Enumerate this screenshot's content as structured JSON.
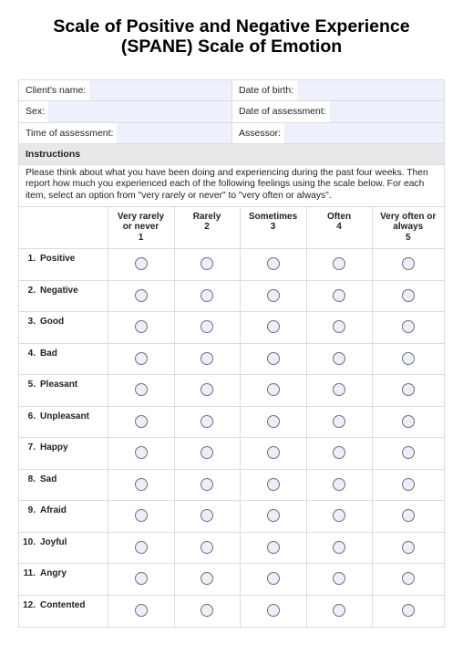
{
  "title_line1": "Scale of Positive and Negative Experience",
  "title_line2": "(SPANE) Scale of Emotion",
  "info": {
    "client_name_label": "Client's name:",
    "client_name_value": "",
    "dob_label": "Date of birth:",
    "dob_value": "",
    "sex_label": "Sex:",
    "sex_value": "",
    "date_assessment_label": "Date of assessment:",
    "date_assessment_value": "",
    "time_assessment_label": "Time of assessment:",
    "time_assessment_value": "",
    "assessor_label": "Assessor:",
    "assessor_value": ""
  },
  "instructions": {
    "heading": "Instructions",
    "text": "Please think about what you have been doing and experiencing during the past four weeks. Then report how much you experienced each of the following feelings using the scale below. For each item, select an option from \"very rarely or never\" to \"very often or always\"."
  },
  "scale": [
    {
      "label_1": "Very rarely",
      "label_2": "or never",
      "value": "1"
    },
    {
      "label_1": "Rarely",
      "label_2": "",
      "value": "2"
    },
    {
      "label_1": "Sometimes",
      "label_2": "",
      "value": "3"
    },
    {
      "label_1": "Often",
      "label_2": "",
      "value": "4"
    },
    {
      "label_1": "Very often or",
      "label_2": "always",
      "value": "5"
    }
  ],
  "items": [
    {
      "num": "1.",
      "label": "Positive"
    },
    {
      "num": "2.",
      "label": "Negative"
    },
    {
      "num": "3.",
      "label": "Good"
    },
    {
      "num": "4.",
      "label": "Bad"
    },
    {
      "num": "5.",
      "label": "Pleasant"
    },
    {
      "num": "6.",
      "label": "Unpleasant"
    },
    {
      "num": "7.",
      "label": "Happy"
    },
    {
      "num": "8.",
      "label": "Sad"
    },
    {
      "num": "9.",
      "label": "Afraid"
    },
    {
      "num": "10.",
      "label": "Joyful"
    },
    {
      "num": "11.",
      "label": "Angry"
    },
    {
      "num": "12.",
      "label": "Contented"
    }
  ]
}
